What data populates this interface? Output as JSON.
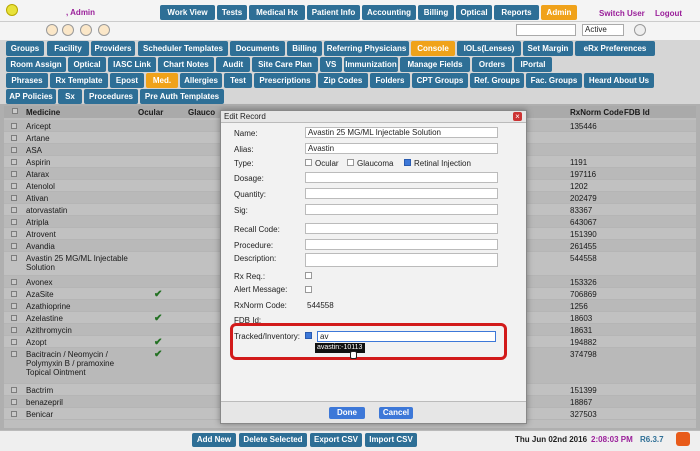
{
  "header": {
    "user": ", Admin",
    "nav": [
      "Work View",
      "Tests",
      "Medical Hx",
      "Patient Info",
      "Accounting",
      "Billing",
      "Optical",
      "Reports",
      "Admin"
    ],
    "switch_user": "Switch User",
    "logout": "Logout",
    "status": "Active"
  },
  "subnav": {
    "row1": [
      "Groups",
      "Facility",
      "Providers",
      "Scheduler Templates",
      "Documents",
      "Billing",
      "Referring Physicians",
      "Console",
      "IOLs(Lenses)",
      "Set Margin",
      "eRx Preferences"
    ],
    "row2": [
      "Room Assign",
      "Optical",
      "IASC Link",
      "Chart Notes",
      "Audit",
      "Site Care Plan",
      "VS",
      "Immunization",
      "Manage Fields",
      "Orders",
      "IPortal"
    ],
    "row3": [
      "Phrases",
      "Rx Template",
      "Epost",
      "Med.",
      "Allergies",
      "Test",
      "Prescriptions",
      "Zip Codes",
      "Folders",
      "CPT Groups",
      "Ref. Groups",
      "Fac. Groups",
      "Heard About Us"
    ],
    "row4": [
      "AP Policies",
      "Sx",
      "Procedures",
      "Pre Auth Templates"
    ]
  },
  "grid": {
    "headers": {
      "medicine": "Medicine",
      "ocular": "Ocular",
      "glaucoma": "Glauco",
      "rxnorm": "RxNorm Code",
      "fdb": "FDB Id"
    },
    "rows": [
      {
        "name": "Aricept",
        "ocular": false,
        "rx": "135446"
      },
      {
        "name": "Artane",
        "ocular": false,
        "rx": ""
      },
      {
        "name": "ASA",
        "ocular": false,
        "rx": ""
      },
      {
        "name": "Aspirin",
        "ocular": false,
        "rx": "1191"
      },
      {
        "name": "Atarax",
        "ocular": false,
        "rx": "197116"
      },
      {
        "name": "Atenolol",
        "ocular": false,
        "rx": "1202"
      },
      {
        "name": "Ativan",
        "ocular": false,
        "rx": "202479"
      },
      {
        "name": "atorvastatin",
        "ocular": false,
        "rx": "83367"
      },
      {
        "name": "Atripla",
        "ocular": false,
        "rx": "643067"
      },
      {
        "name": "Atrovent",
        "ocular": false,
        "rx": "151390"
      },
      {
        "name": "Avandia",
        "ocular": false,
        "rx": "261455"
      },
      {
        "name": "Avastin 25 MG/ML Injectable Solution",
        "ocular": false,
        "rx": "544558"
      },
      {
        "name": "Avonex",
        "ocular": false,
        "rx": "153326"
      },
      {
        "name": "AzaSite",
        "ocular": true,
        "rx": "706869"
      },
      {
        "name": "Azathioprine",
        "ocular": false,
        "rx": "1256"
      },
      {
        "name": "Azelastine",
        "ocular": true,
        "rx": "18603"
      },
      {
        "name": "Azithromycin",
        "ocular": false,
        "rx": "18631"
      },
      {
        "name": "Azopt",
        "ocular": true,
        "rx": "194882"
      },
      {
        "name": "Bacitracin / Neomycin / Polymyxin B / pramoxine Topical Ointment",
        "ocular": true,
        "rx": "374798"
      },
      {
        "name": "Bactrim",
        "ocular": false,
        "rx": "151399"
      },
      {
        "name": "benazepril",
        "ocular": false,
        "rx": "18867"
      },
      {
        "name": "Benicar",
        "ocular": false,
        "rx": "327503"
      }
    ]
  },
  "footer": {
    "add_new": "Add New",
    "delete_selected": "Delete Selected",
    "export_csv": "Export CSV",
    "import_csv": "Import CSV",
    "date": "Thu Jun 02nd 2016",
    "time": "2:08:03 PM",
    "version": "R6.3.7"
  },
  "dialog": {
    "title": "Edit Record",
    "name_label": "Name:",
    "name_value": "Avastin 25 MG/ML Injectable Solution",
    "alias_label": "Alias:",
    "alias_value": "Avastin",
    "type_label": "Type:",
    "type_ocular": "Ocular",
    "type_glaucoma": "Glaucoma",
    "type_retinal": "Retinal Injection",
    "dosage_label": "Dosage:",
    "quantity_label": "Quantity:",
    "sig_label": "Sig:",
    "recall_label": "Recall Code:",
    "procedure_label": "Procedure:",
    "description_label": "Description:",
    "rxreq_label": "Rx Req.:",
    "alert_label": "Alert Message:",
    "rxnorm_label": "RxNorm Code:",
    "rxnorm_value": "544558",
    "fdb_label": "FDB Id:",
    "tracked_label": "Tracked/Inventory:",
    "tracked_value": "av",
    "suggestion": "avastin:-10113",
    "done": "Done",
    "cancel": "Cancel"
  },
  "colors": {
    "nav": "#2e6f96",
    "active": "#f0a21a",
    "highlight": "#d21b1b"
  }
}
